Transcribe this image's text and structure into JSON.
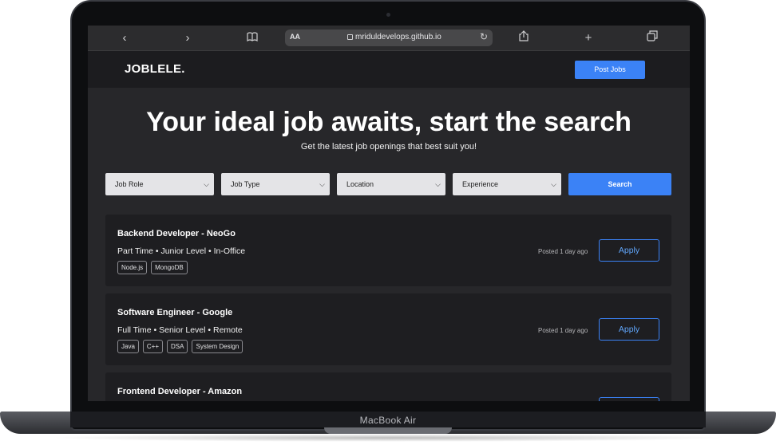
{
  "device": {
    "label": "MacBook Air"
  },
  "browser": {
    "url": "mriduldevelops.github.io",
    "text_size_label": "AA"
  },
  "site": {
    "brand": "JOBLELE.",
    "post_jobs_label": "Post Jobs"
  },
  "hero": {
    "title": "Your ideal job awaits, start the search",
    "subtitle": "Get the latest job openings that best suit you!"
  },
  "filters": {
    "job_role": "Job Role",
    "job_type": "Job Type",
    "location": "Location",
    "experience": "Experience",
    "search_label": "Search"
  },
  "jobs": [
    {
      "title": "Backend Developer - NeoGo",
      "meta": "Part Time • Junior Level • In-Office",
      "tags": [
        "Node.js",
        "MongoDB"
      ],
      "posted": "Posted 1 day ago",
      "apply_label": "Apply"
    },
    {
      "title": "Software Engineer - Google",
      "meta": "Full Time • Senior Level • Remote",
      "tags": [
        "Java",
        "C++",
        "DSA",
        "System Design"
      ],
      "posted": "Posted 1 day ago",
      "apply_label": "Apply"
    },
    {
      "title": "Frontend Developer - Amazon",
      "meta": "",
      "tags": [],
      "posted": "",
      "apply_label": ""
    }
  ],
  "colors": {
    "accent": "#3b82f6",
    "page_bg": "#27272a",
    "card_bg": "#1e1e21",
    "nav_bg": "#1c1c1f"
  }
}
